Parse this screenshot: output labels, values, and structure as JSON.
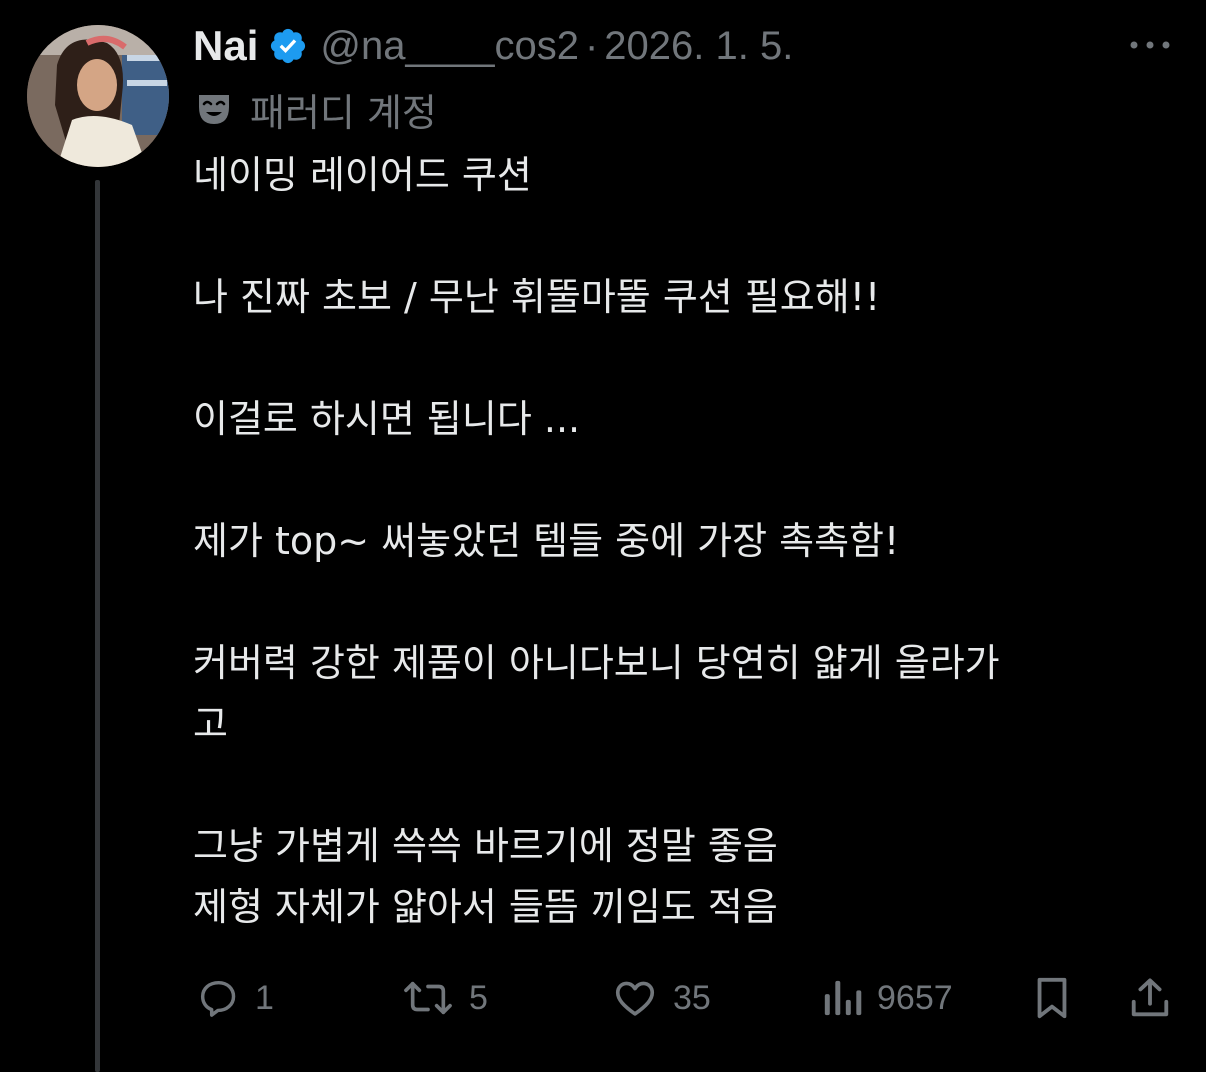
{
  "tweet": {
    "display_name": "Nai",
    "verified_icon": "verified-badge-icon",
    "handle": "@na____cos2",
    "separator": "·",
    "date": "2026. 1. 5.",
    "parody_label": "패러디 계정",
    "body": [
      "네이밍 레이어드 쿠션",
      "나 진짜 초보 / 무난 휘뚤마뚤 쿠션 필요해!!",
      "이걸로 하시면 됩니다 ...",
      "제가 top~ 써놓았던 템들 중에 가장 촉촉함!",
      "커버력 강한 제품이 아니다보니 당연히 얇게 올라가\n고",
      "그냥 가볍게 쓱쓱 바르기에 정말 좋음\n제형 자체가 얇아서 들뜸 끼임도 적음"
    ]
  },
  "actions": {
    "reply_count": "1",
    "repost_count": "5",
    "like_count": "35",
    "view_count": "9657"
  },
  "colors": {
    "background": "#000000",
    "text": "#e7e9ea",
    "muted": "#71767b",
    "verified": "#1d9bf0",
    "thread_line": "#333639"
  }
}
